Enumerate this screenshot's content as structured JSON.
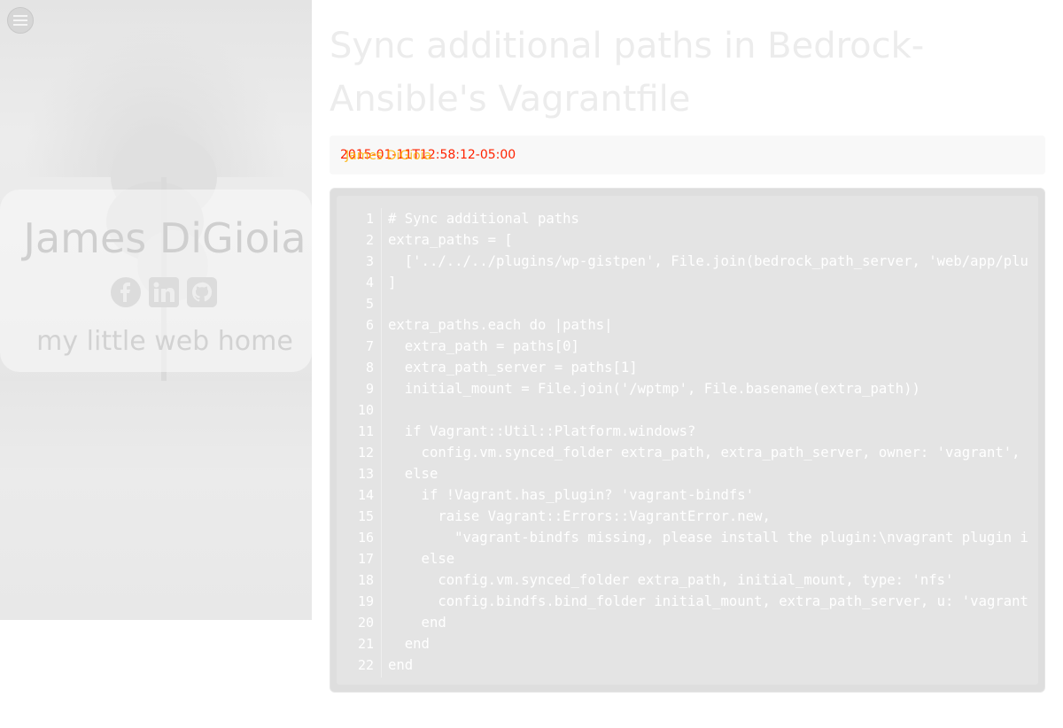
{
  "sidebar": {
    "menu_icon": "hamburger-menu-icon",
    "name": "James DiGioia",
    "tagline": "my little web home",
    "social_icons": [
      "facebook-icon",
      "linkedin-icon",
      "github-icon"
    ]
  },
  "post": {
    "title": "Sync additional paths in Bedrock-Ansible's Vagrantfile",
    "meta_a": "2015-01-11T12:58:12-05:00",
    "meta_b": "James DiGioia"
  },
  "code": {
    "line_numbers": [
      "1",
      "2",
      "3",
      "4",
      "5",
      "6",
      "7",
      "8",
      "9",
      "10",
      "11",
      "12",
      "13",
      "14",
      "15",
      "16",
      "17",
      "18",
      "19",
      "20",
      "21",
      "22"
    ],
    "lines": [
      "# Sync additional paths",
      "extra_paths = [",
      "  ['../../../plugins/wp-gistpen', File.join(bedrock_path_server, 'web/app/plu",
      "]",
      "",
      "extra_paths.each do |paths|",
      "  extra_path = paths[0]",
      "  extra_path_server = paths[1]",
      "  initial_mount = File.join('/wptmp', File.basename(extra_path))",
      "",
      "  if Vagrant::Util::Platform.windows?",
      "    config.vm.synced_folder extra_path, extra_path_server, owner: 'vagrant', ",
      "  else",
      "    if !Vagrant.has_plugin? 'vagrant-bindfs'",
      "      raise Vagrant::Errors::VagrantError.new,",
      "        \"vagrant-bindfs missing, please install the plugin:\\nvagrant plugin i",
      "    else",
      "      config.vm.synced_folder extra_path, initial_mount, type: 'nfs'",
      "      config.bindfs.bind_folder initial_mount, extra_path_server, u: 'vagrant",
      "    end",
      "  end",
      "end"
    ]
  },
  "colors": {
    "background": "#ffffff",
    "code_bg": "#e4e4e4",
    "meta_text": "#ff2200",
    "code_text": "#ffffff"
  }
}
